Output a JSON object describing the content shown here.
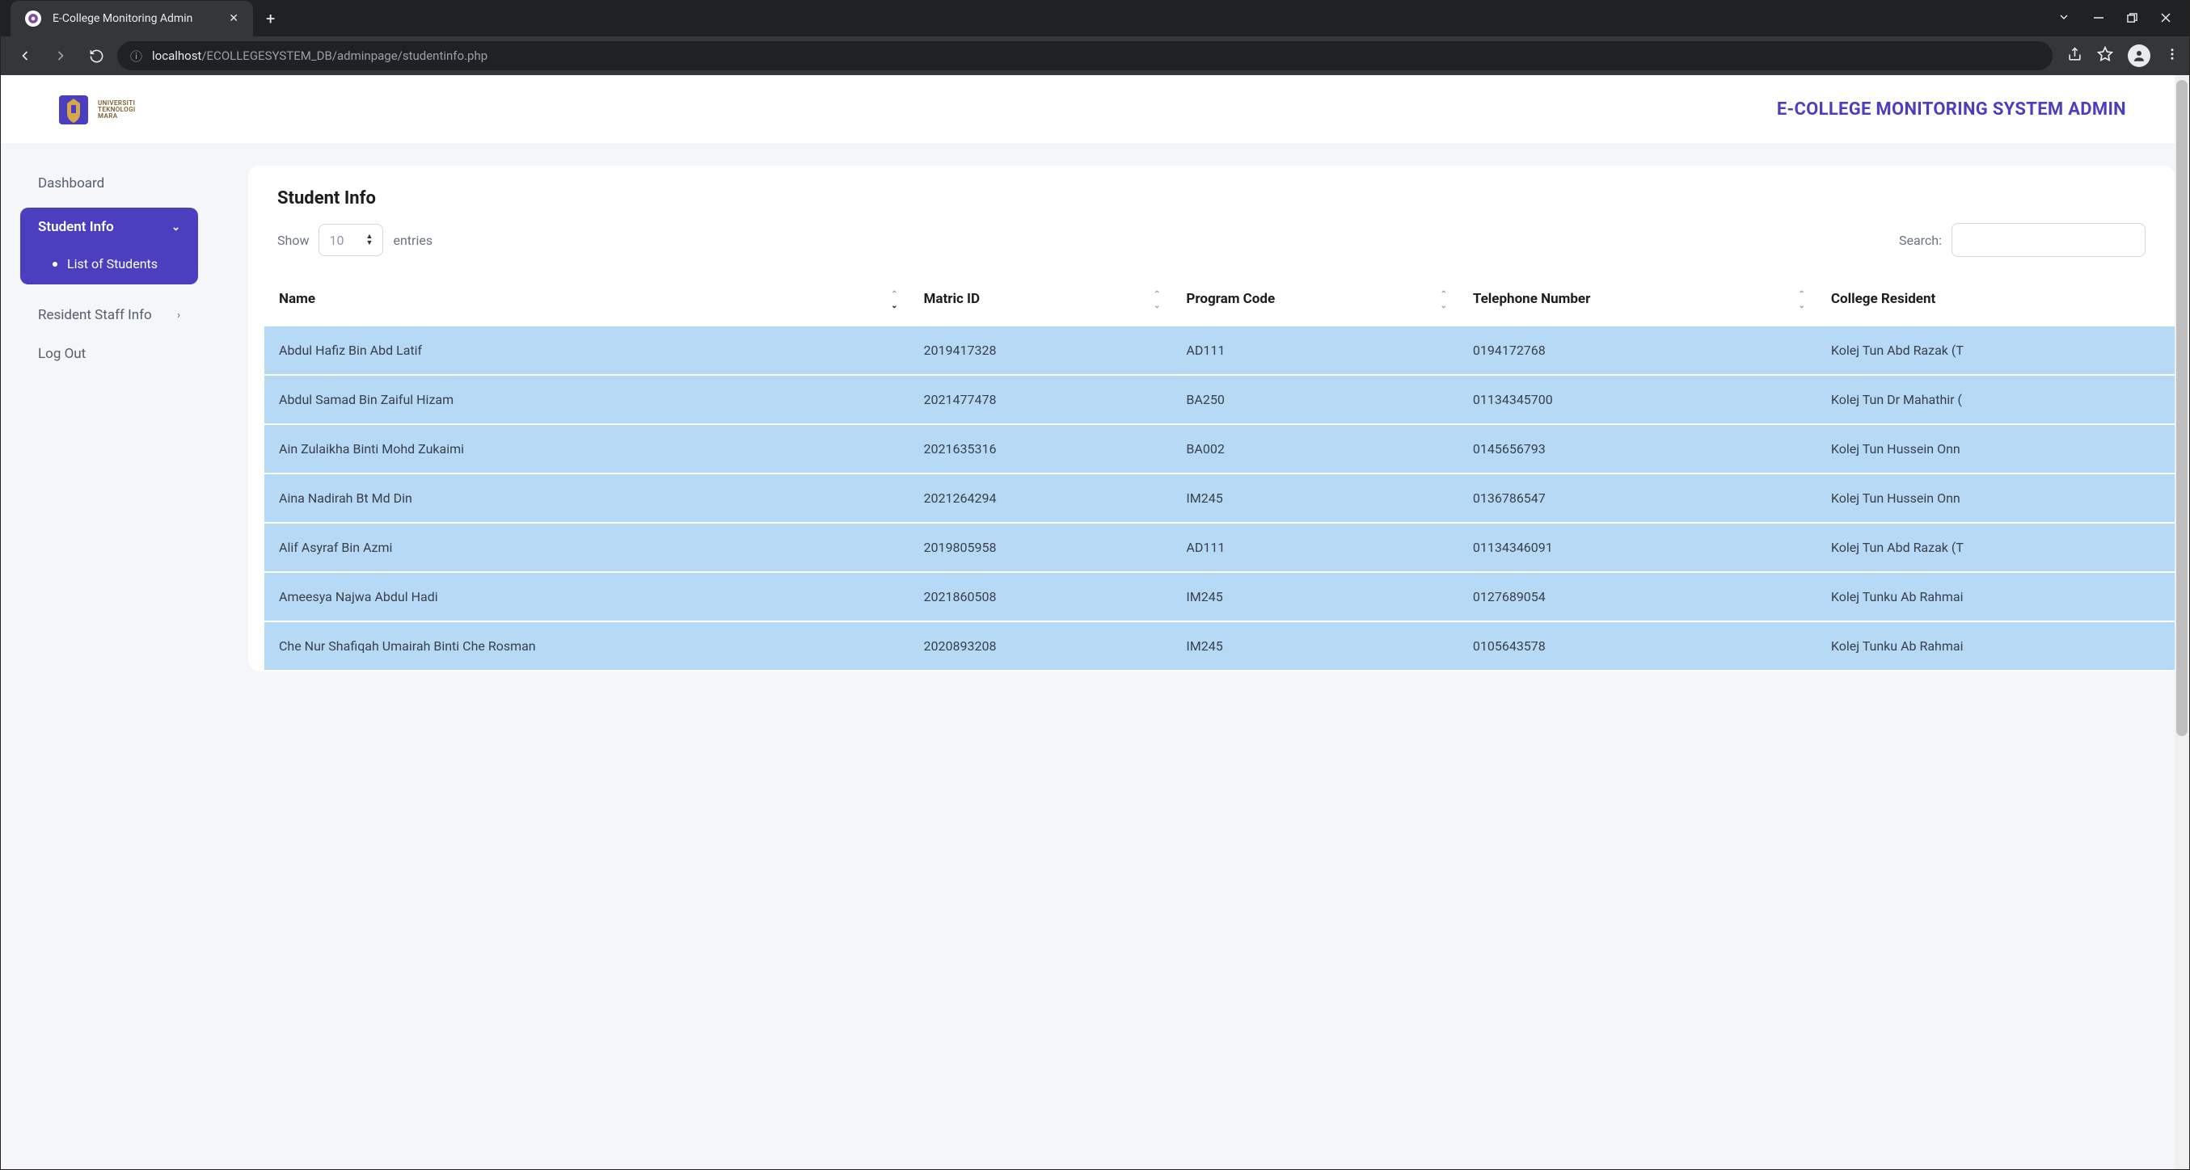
{
  "browser": {
    "tab_title": "E-College Monitoring Admin",
    "url_host": "localhost",
    "url_path": "/ECOLLEGESYSTEM_DB/adminpage/studentinfo.php"
  },
  "header": {
    "logo_lines": [
      "UNIVERSITI",
      "TEKNOLOGI",
      "MARA"
    ],
    "app_title": "E-COLLEGE MONITORING SYSTEM ADMIN"
  },
  "sidebar": {
    "dashboard": "Dashboard",
    "student_info": "Student Info",
    "student_sub": "List of Students",
    "resident_staff": "Resident Staff Info",
    "logout": "Log Out"
  },
  "main": {
    "title": "Student Info",
    "show_label": "Show",
    "entries_label": "entries",
    "page_len": "10",
    "search_label": "Search:",
    "search_value": "",
    "columns": {
      "name": "Name",
      "matric": "Matric ID",
      "program": "Program Code",
      "tel": "Telephone Number",
      "college": "College Resident"
    },
    "rows": [
      {
        "name": "Abdul Hafiz Bin Abd Latif",
        "matric": "2019417328",
        "program": "AD111",
        "tel": "0194172768",
        "college": "Kolej Tun Abd Razak (T"
      },
      {
        "name": "Abdul Samad Bin Zaiful Hizam",
        "matric": "2021477478",
        "program": "BA250",
        "tel": "01134345700",
        "college": "Kolej Tun Dr Mahathir ("
      },
      {
        "name": "Ain Zulaikha Binti Mohd Zukaimi",
        "matric": "2021635316",
        "program": "BA002",
        "tel": "0145656793",
        "college": "Kolej Tun Hussein Onn"
      },
      {
        "name": "Aina Nadirah Bt Md Din",
        "matric": "2021264294",
        "program": "IM245",
        "tel": "0136786547",
        "college": "Kolej Tun Hussein Onn"
      },
      {
        "name": "Alif Asyraf Bin Azmi",
        "matric": "2019805958",
        "program": "AD111",
        "tel": "01134346091",
        "college": "Kolej Tun Abd Razak (T"
      },
      {
        "name": "Ameesya Najwa Abdul Hadi",
        "matric": "2021860508",
        "program": "IM245",
        "tel": "0127689054",
        "college": "Kolej Tunku Ab Rahmai"
      },
      {
        "name": "Che Nur Shafiqah Umairah Binti Che Rosman",
        "matric": "2020893208",
        "program": "IM245",
        "tel": "0105643578",
        "college": "Kolej Tunku Ab Rahmai"
      }
    ]
  }
}
